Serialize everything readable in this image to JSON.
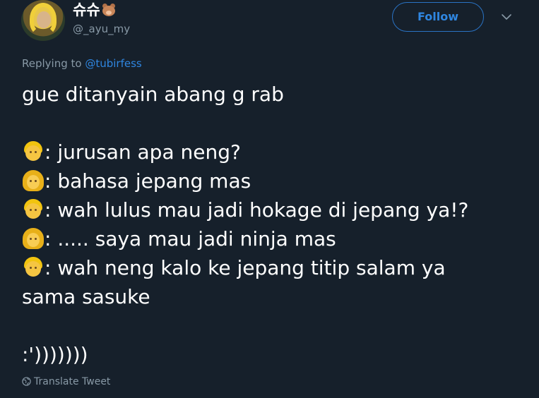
{
  "user": {
    "display_name": "슈슈",
    "name_emoji": "bear-face",
    "handle": "@_ayu_my"
  },
  "header": {
    "follow_label": "Follow",
    "more_icon": "chevron-down-icon"
  },
  "reply": {
    "prefix": "Replying to",
    "mention": "@tubirfess"
  },
  "tweet": {
    "intro": "gue ditanyain abang g rab",
    "lines": [
      {
        "speaker": "man",
        "text": ": jurusan apa neng?"
      },
      {
        "speaker": "woman",
        "text": ": bahasa jepang mas"
      },
      {
        "speaker": "man",
        "text": ": wah lulus mau jadi hokage di jepang ya!?"
      },
      {
        "speaker": "woman",
        "text": ": ..... saya mau jadi ninja mas"
      },
      {
        "speaker": "man",
        "text": ": wah neng kalo ke jepang titip salam ya"
      }
    ],
    "continuation": "sama sasuke",
    "closing": ":')))))))"
  },
  "footer": {
    "translate_label": "Translate Tweet"
  },
  "colors": {
    "background": "#16202b",
    "accent": "#2f86e0",
    "muted": "#8899a6"
  }
}
